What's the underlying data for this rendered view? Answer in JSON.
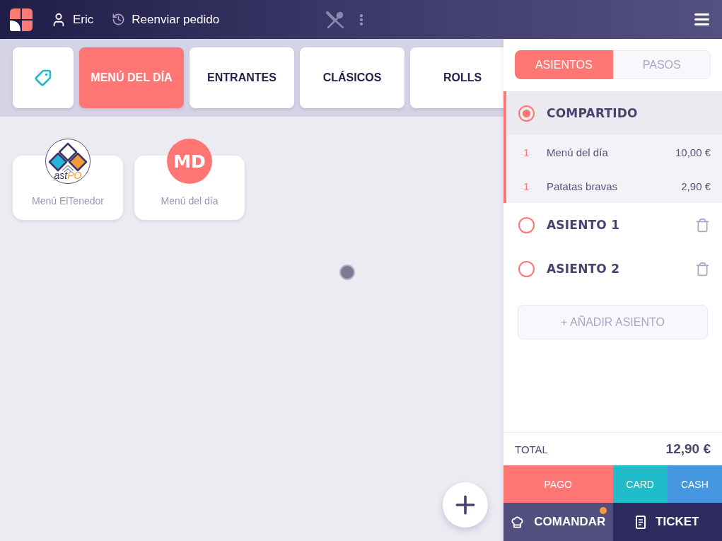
{
  "top_bar": {
    "user": "Eric",
    "resend": "Reenviar pedido"
  },
  "categories": [
    {
      "kind": "icon",
      "selected": false
    },
    {
      "kind": "text",
      "label": "MENÚ DEL DÍA",
      "selected": true
    },
    {
      "kind": "text",
      "label": "ENTRANTES",
      "selected": false
    },
    {
      "kind": "text",
      "label": "CLÁSICOS",
      "selected": false
    },
    {
      "kind": "text",
      "label": "ROLLS",
      "selected": false
    }
  ],
  "products": [
    {
      "kind": "logo",
      "label": "Menú ElTenedor",
      "logo_words": [
        {
          "text": "ast",
          "color": "#3d3566"
        },
        {
          "text": "PO",
          "color": "#f39a3a"
        }
      ]
    },
    {
      "kind": "initials",
      "label": "Menú del día",
      "initials": "MD",
      "color": "#ff7675"
    }
  ],
  "side_tabs": [
    {
      "label": "ASIENTOS",
      "selected": true
    },
    {
      "label": "PASOS",
      "selected": false
    }
  ],
  "seats": [
    {
      "name": "COMPARTIDO",
      "selected": true,
      "deletable": false,
      "items": [
        {
          "qty": "1",
          "name": "Menú del día",
          "price": "10,00 €"
        },
        {
          "qty": "1",
          "name": "Patatas bravas",
          "price": "2,90 €"
        }
      ]
    },
    {
      "name": "ASIENTO 1",
      "selected": false,
      "deletable": true
    },
    {
      "name": "ASIENTO 2",
      "selected": false,
      "deletable": true
    }
  ],
  "add_seat": "+ AÑADIR ASIENTO",
  "total": {
    "label": "TOTAL",
    "value": "12,90 €"
  },
  "payment_buttons": [
    {
      "label": "PAGO",
      "color": "#ff7675"
    },
    {
      "label": "CARD",
      "color": "#20bcca"
    },
    {
      "label": "CASH",
      "color": "#4497e0"
    }
  ],
  "actions": [
    {
      "kind": "comandar",
      "label": "COMANDAR",
      "notification": true
    },
    {
      "kind": "ticket",
      "label": "TICKET",
      "notification": false
    }
  ]
}
